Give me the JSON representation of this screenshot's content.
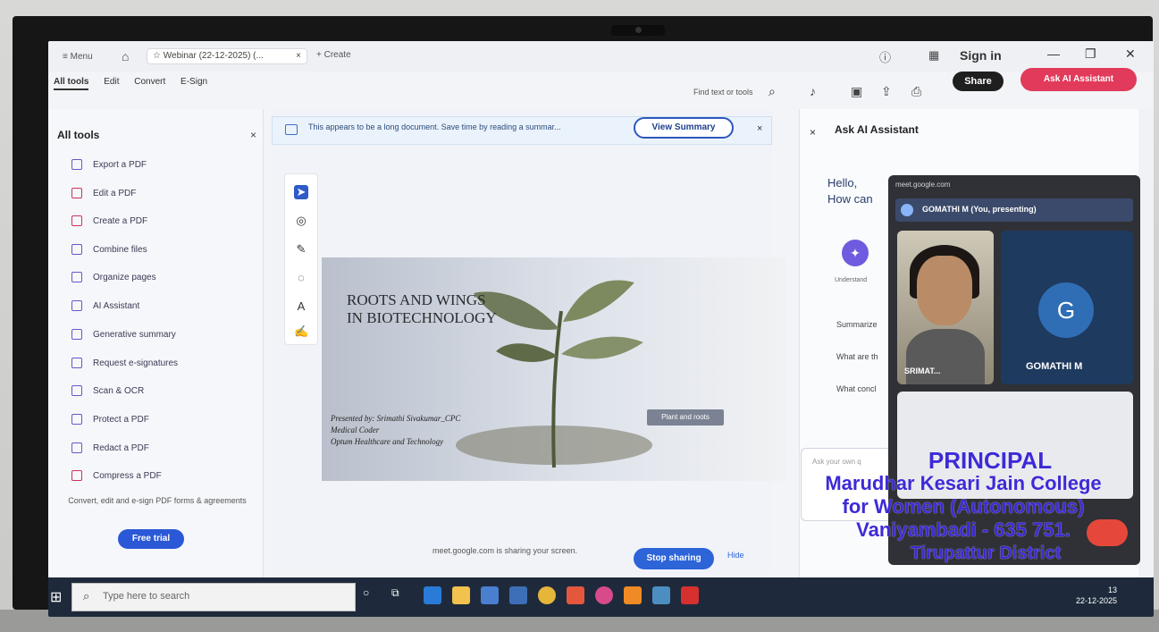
{
  "titlebar": {
    "menu_label": "Menu",
    "tab_label": "Webinar (22-12-2025) (...",
    "create_label": "+ Create",
    "sign_in": "Sign in"
  },
  "modes": [
    "All tools",
    "Edit",
    "Convert",
    "E-Sign"
  ],
  "toolbar": {
    "find_placeholder": "Find text or tools",
    "share_label": "Share",
    "ai_label": "Ask AI Assistant"
  },
  "tools_panel": {
    "title": "All tools",
    "items": [
      {
        "label": "Export a PDF",
        "icon": "export-icon"
      },
      {
        "label": "Edit a PDF",
        "icon": "edit-icon"
      },
      {
        "label": "Create a PDF",
        "icon": "create-icon"
      },
      {
        "label": "Combine files",
        "icon": "combine-icon"
      },
      {
        "label": "Organize pages",
        "icon": "organize-icon"
      },
      {
        "label": "AI Assistant",
        "icon": "ai-icon"
      },
      {
        "label": "Generative summary",
        "icon": "summary-icon"
      },
      {
        "label": "Request e-signatures",
        "icon": "signature-icon"
      },
      {
        "label": "Scan & OCR",
        "icon": "scan-icon"
      },
      {
        "label": "Protect a PDF",
        "icon": "protect-icon"
      },
      {
        "label": "Redact a PDF",
        "icon": "redact-icon"
      },
      {
        "label": "Compress a PDF",
        "icon": "compress-icon"
      }
    ],
    "description": "Convert, edit and e-sign PDF forms & agreements",
    "trial_label": "Free trial"
  },
  "banner": {
    "message": "This appears to be a long document. Save time by reading a summar...",
    "view_summary": "View Summary"
  },
  "slide": {
    "title": "ROOTS AND WINGS\nIN BIOTECHNOLOGY",
    "presented_by": "Presented by: Srimathi Sivakumar_CPC",
    "role": "Medical Coder",
    "company": "Optum Healthcare and Technology",
    "tooltip": "Plant and roots"
  },
  "share_bar": {
    "message": "meet.google.com is sharing your screen.",
    "stop_label": "Stop sharing",
    "hide_label": "Hide"
  },
  "ai_panel": {
    "title": "Ask AI Assistant",
    "hello_line1": "Hello,",
    "hello_line2": "How can",
    "understand": "Understand",
    "q1": "Summarize",
    "q2": "What are th",
    "q3": "What concl",
    "input_placeholder": "Ask your own q"
  },
  "meet": {
    "url": "meet.google.com",
    "presenting": "GOMATHI M (You, presenting)",
    "tile1_name": "SRIMAT...",
    "tile2_initial": "G",
    "tile2_name": "GOMATHI M"
  },
  "stamp": {
    "line1": "PRINCIPAL",
    "line2": "Marudhar Kesari Jain College",
    "line3": "for Women (Autonomous)",
    "line4": "Vaniyambadi - 635 751.",
    "line5": "Tirupattur District"
  },
  "taskbar": {
    "search_placeholder": "Type here to search",
    "time": "13",
    "date": "22-12-2025"
  }
}
